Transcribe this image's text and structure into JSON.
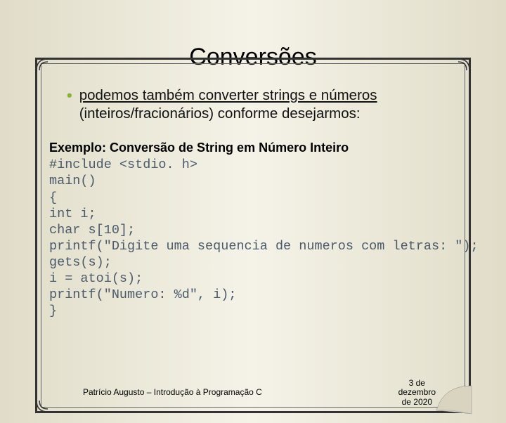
{
  "title": "Conversões",
  "bullet": {
    "line1a": "podemos também converter strings e números",
    "line2": "(inteiros/fracionários) conforme desejarmos:"
  },
  "example": {
    "heading": "Exemplo: Conversão de String em Número Inteiro",
    "code": "#include <stdio. h>\nmain()\n{\nint i;\nchar s[10];\nprintf(\"Digite uma sequencia de numeros com letras: \");\ngets(s);\ni = atoi(s);\nprintf(\"Numero: %d\", i);\n}"
  },
  "footer": {
    "author": "Patrício Augusto – Introdução à Programação C",
    "date": "3 de\ndezembro\nde 2020"
  }
}
